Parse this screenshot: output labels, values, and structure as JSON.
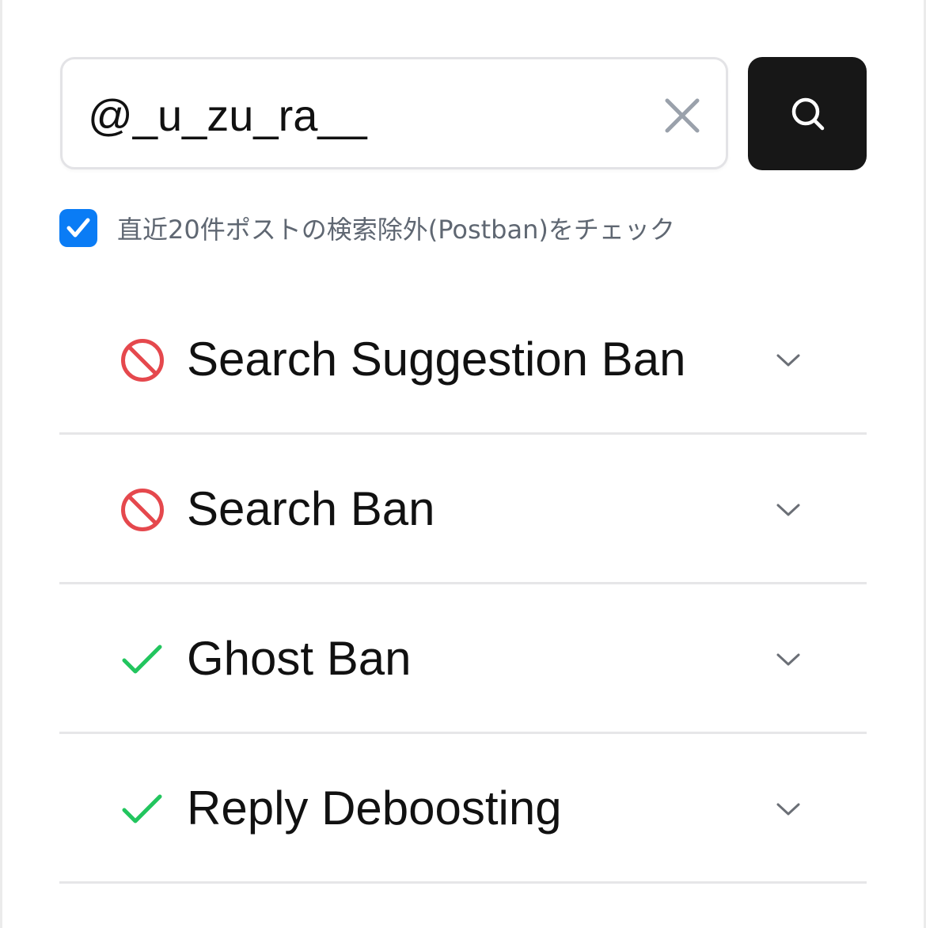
{
  "search": {
    "value": "@_u_zu_ra__",
    "clear_icon": "close-icon",
    "button_icon": "search-icon"
  },
  "postban_check": {
    "label": "直近20件ポストの検索除外(Postban)をチェック",
    "checked": true
  },
  "colors": {
    "accent_blue": "#0a7cf5",
    "ban_red": "#e5484d",
    "ok_green": "#22c55e",
    "button_dark": "#171717"
  },
  "results": [
    {
      "label": "Search Suggestion Ban",
      "status": "banned",
      "icon": "prohibited-icon"
    },
    {
      "label": "Search Ban",
      "status": "banned",
      "icon": "prohibited-icon"
    },
    {
      "label": "Ghost Ban",
      "status": "ok",
      "icon": "checkmark-icon"
    },
    {
      "label": "Reply Deboosting",
      "status": "ok",
      "icon": "checkmark-icon"
    }
  ]
}
